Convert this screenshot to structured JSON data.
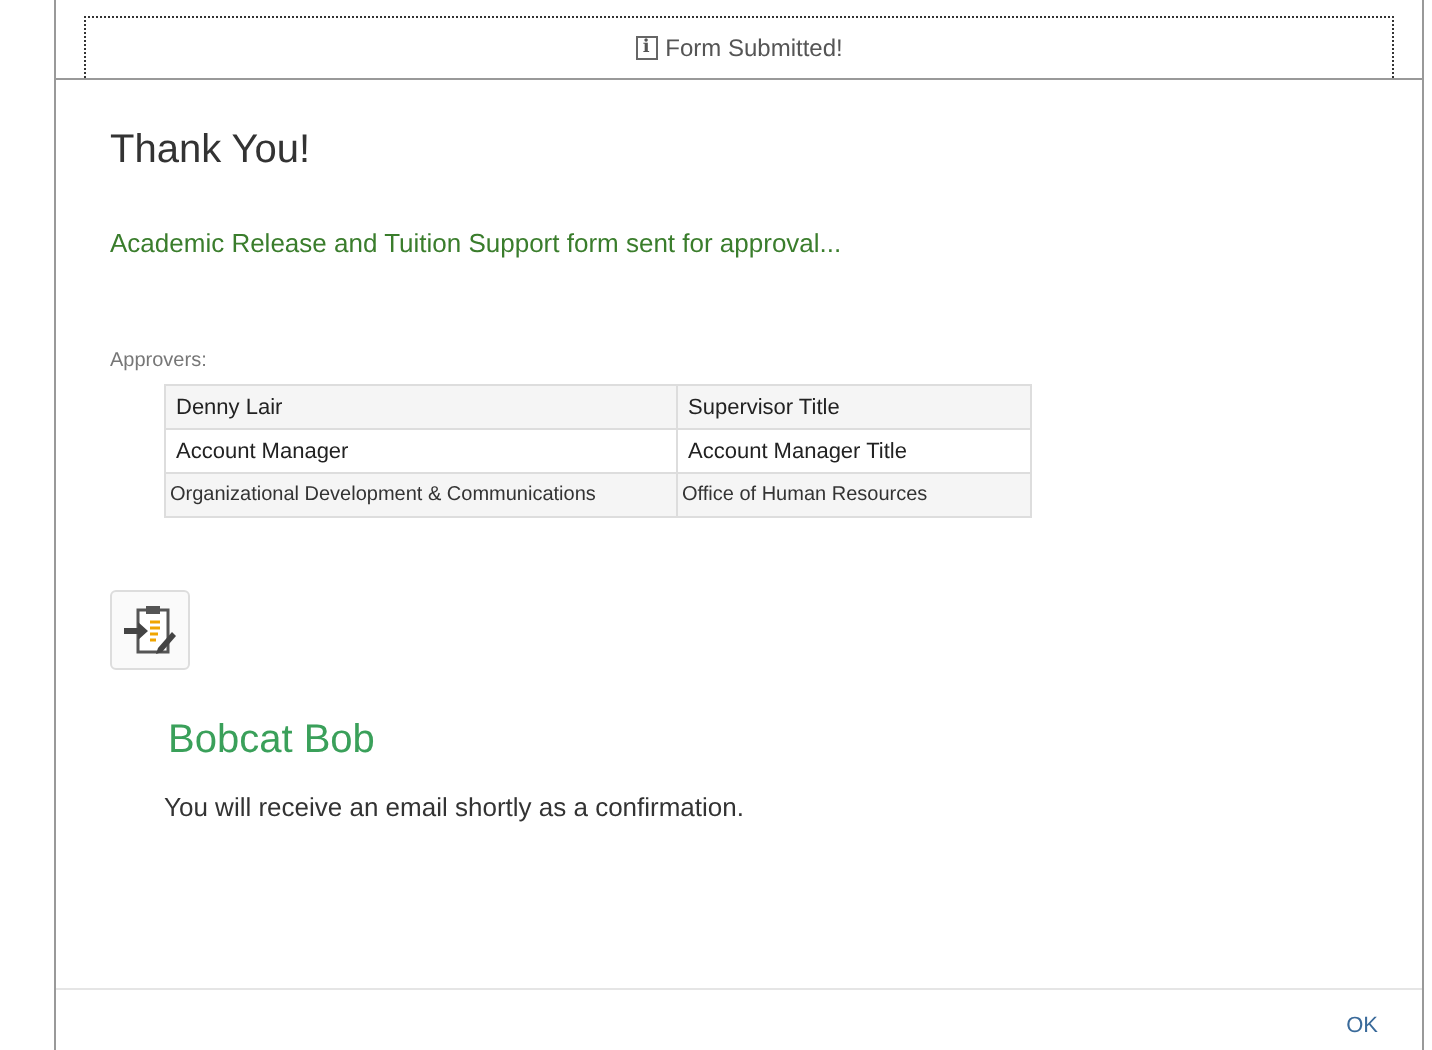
{
  "banner": {
    "icon": "i",
    "title": "Form Submitted!"
  },
  "heading": "Thank You!",
  "message": "Academic Release and Tuition Support form sent for approval...",
  "approvers_label": "Approvers:",
  "approvers": [
    {
      "name": "Denny Lair",
      "title": "Supervisor Title"
    },
    {
      "name": "Account Manager",
      "title": "Account Manager Title"
    },
    {
      "name": "Organizational Development & Communications",
      "title": "Office of Human Resources"
    }
  ],
  "signer": "Bobcat Bob",
  "confirmation": "You will receive an email shortly as a confirmation.",
  "buttons": [
    "OK"
  ]
}
